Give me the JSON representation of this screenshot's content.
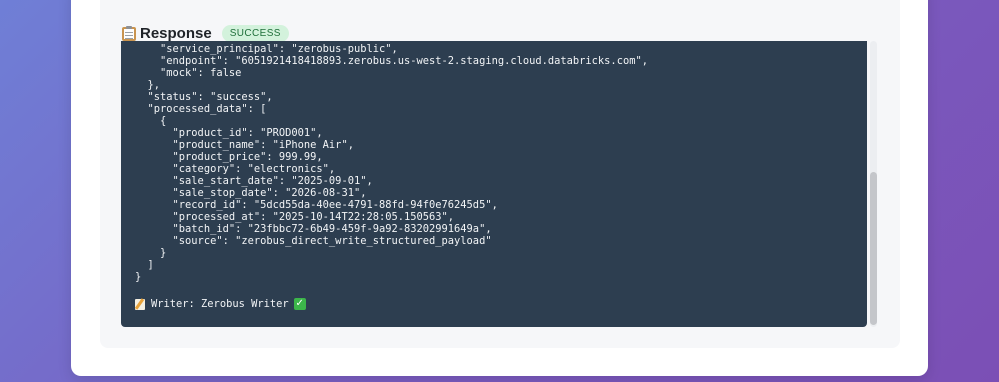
{
  "response": {
    "title": "Response",
    "badge": "SUCCESS",
    "header_icon": "clipboard-icon"
  },
  "code": {
    "lines": [
      "    \"service_principal\": \"zerobus-public\",",
      "    \"endpoint\": \"6051921418418893.zerobus.us-west-2.staging.cloud.databricks.com\",",
      "    \"mock\": false",
      "  },",
      "  \"status\": \"success\",",
      "  \"processed_data\": [",
      "    {",
      "      \"product_id\": \"PROD001\",",
      "      \"product_name\": \"iPhone Air\",",
      "      \"product_price\": 999.99,",
      "      \"category\": \"electronics\",",
      "      \"sale_start_date\": \"2025-09-01\",",
      "      \"sale_stop_date\": \"2026-08-31\",",
      "      \"record_id\": \"5dcd55da-40ee-4791-88fd-94f0e76245d5\",",
      "      \"processed_at\": \"2025-10-14T22:28:05.150563\",",
      "      \"batch_id\": \"23fbbc72-6b49-459f-9a92-83202991649a\",",
      "      \"source\": \"zerobus_direct_write_structured_payload\"",
      "    }",
      "  ]",
      "}"
    ],
    "writer": "Writer: Zerobus Writer",
    "writer_icon": "memo-icon",
    "status_icon": "check-mark-icon"
  },
  "colors": {
    "code_bg": "#2d3e50",
    "badge_bg": "#d3f2dc",
    "badge_text": "#1f6f3a"
  }
}
